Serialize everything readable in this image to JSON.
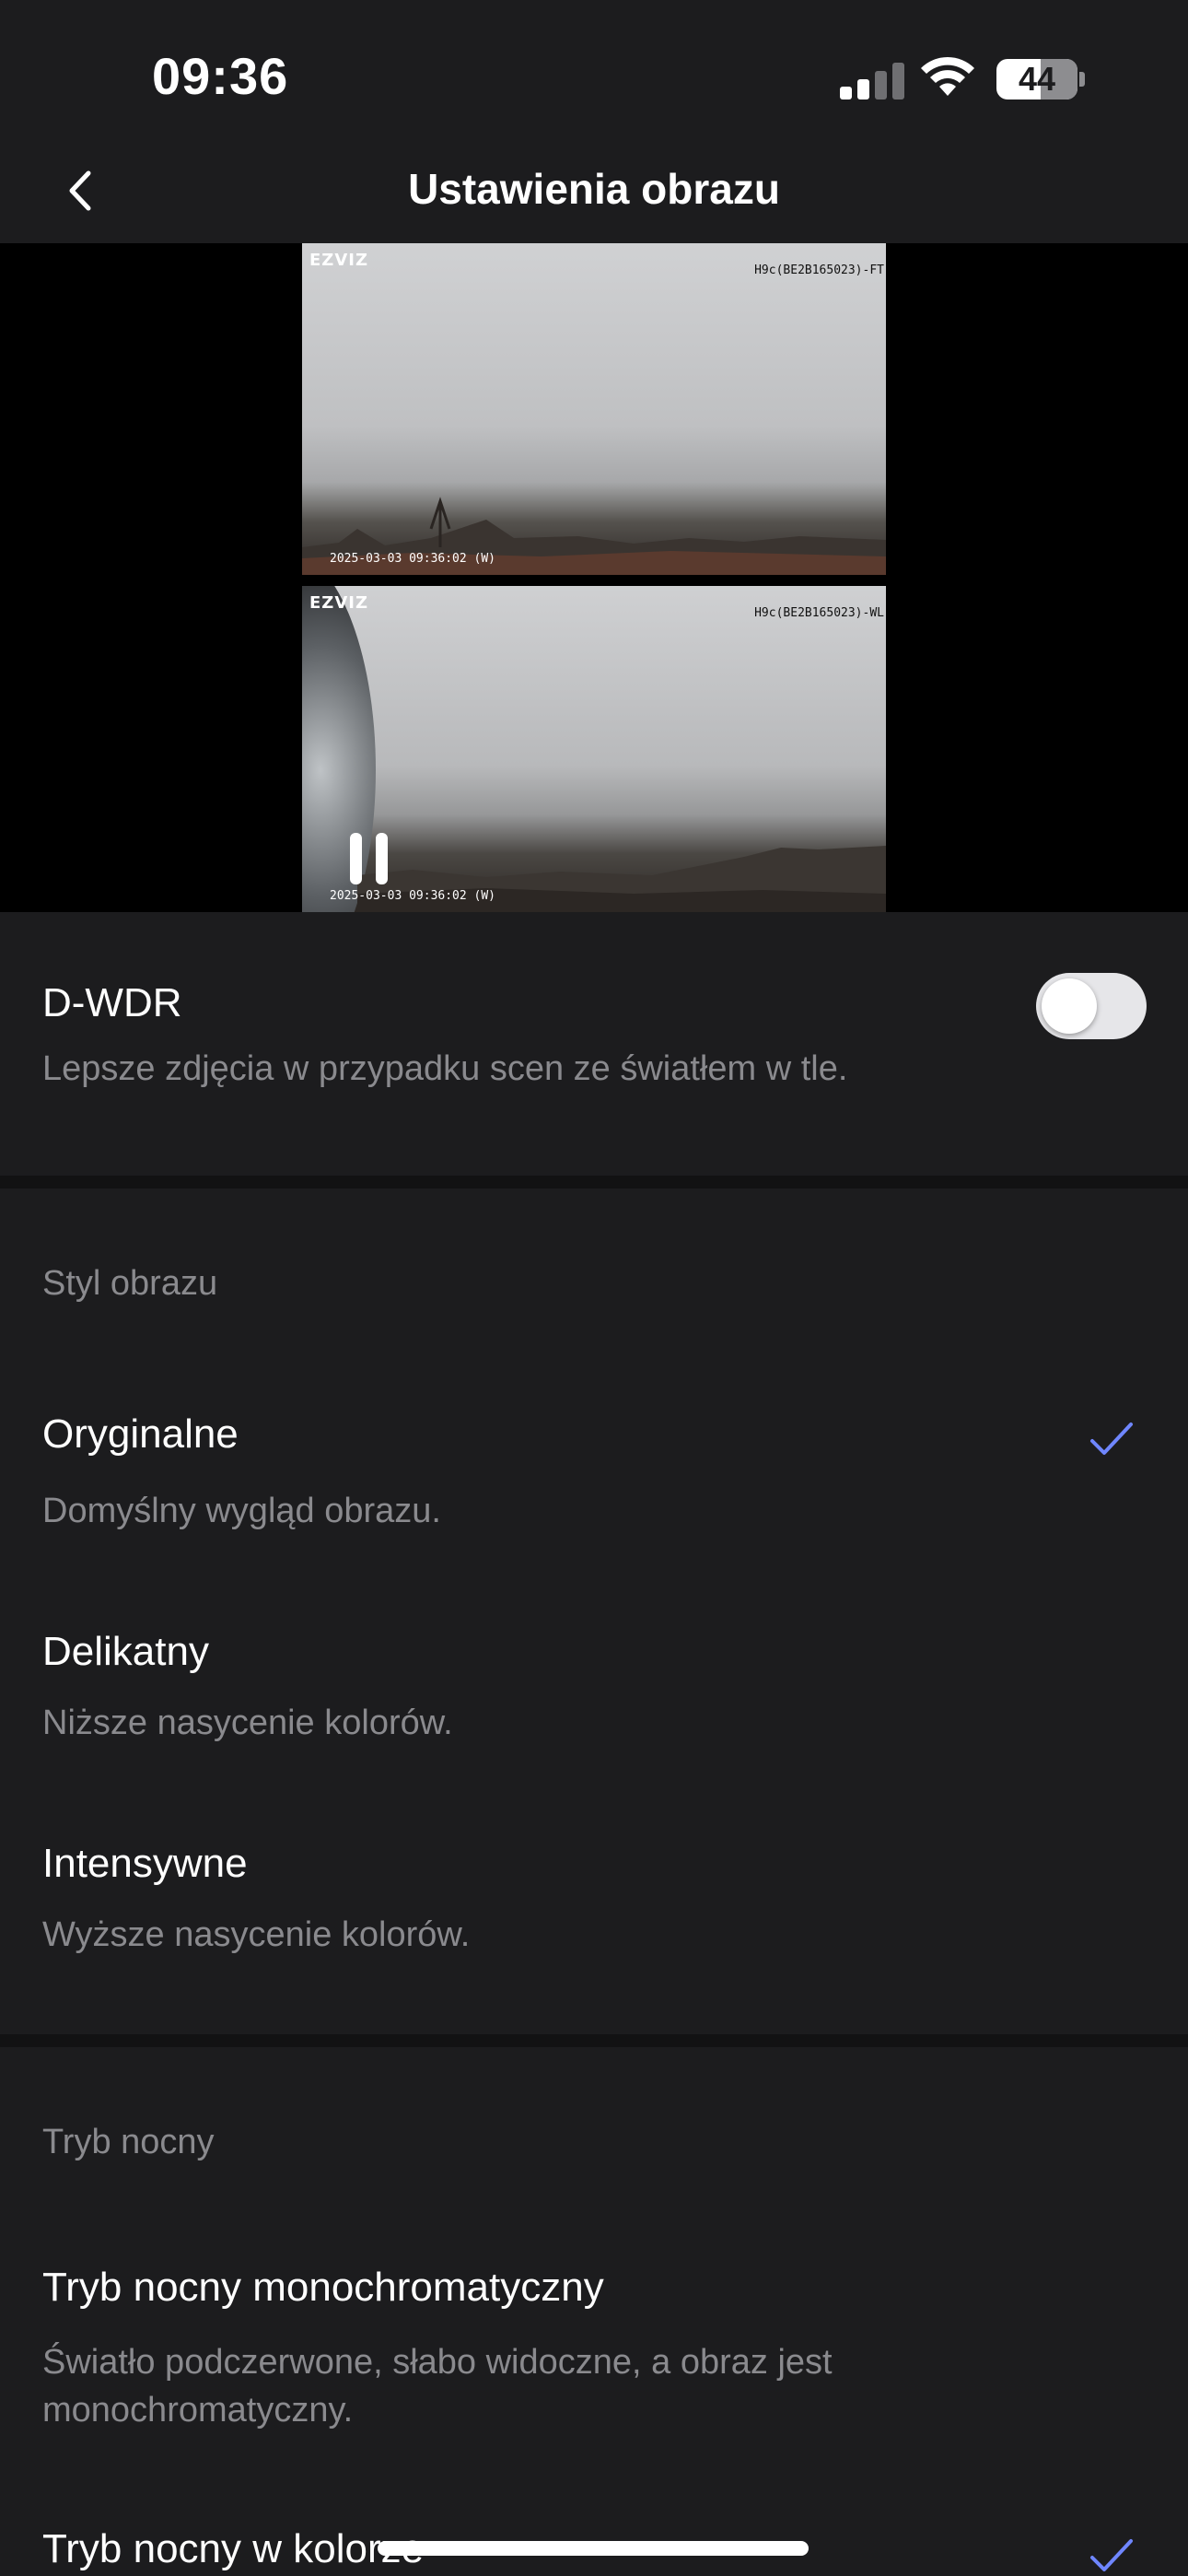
{
  "status_bar": {
    "time": "09:36",
    "battery": "44"
  },
  "nav": {
    "title": "Ustawienia obrazu"
  },
  "preview": {
    "camera_top": {
      "logo": "EZVIZ",
      "id": "H9c(BE2B165023)-FT",
      "timestamp": "2025-03-03 09:36:02 (W)"
    },
    "camera_bottom": {
      "logo": "EZVIZ",
      "id": "H9c(BE2B165023)-WL",
      "timestamp": "2025-03-03 09:36:02 (W)"
    }
  },
  "dwdr": {
    "label": "D-WDR",
    "description": "Lepsze zdjęcia w przypadku scen ze światłem w tle.",
    "enabled": false
  },
  "image_style": {
    "header": "Styl obrazu",
    "options": [
      {
        "title": "Oryginalne",
        "description": "Domyślny wygląd obrazu.",
        "selected": true
      },
      {
        "title": "Delikatny",
        "description": "Niższe nasycenie kolorów.",
        "selected": false
      },
      {
        "title": "Intensywne",
        "description": "Wyższe nasycenie kolorów.",
        "selected": false
      }
    ]
  },
  "night_mode": {
    "header": "Tryb nocny",
    "options": [
      {
        "title": "Tryb nocny monochromatyczny",
        "description": "Światło podczerwone, słabo widoczne, a obraz jest monochromatyczny.",
        "selected": false
      },
      {
        "title": "Tryb nocny w kolorze",
        "description": "",
        "selected": true
      }
    ]
  },
  "colors": {
    "accent": "#6f86ff",
    "background": "#1c1c1e",
    "secondary_text": "#8a8a8e"
  }
}
